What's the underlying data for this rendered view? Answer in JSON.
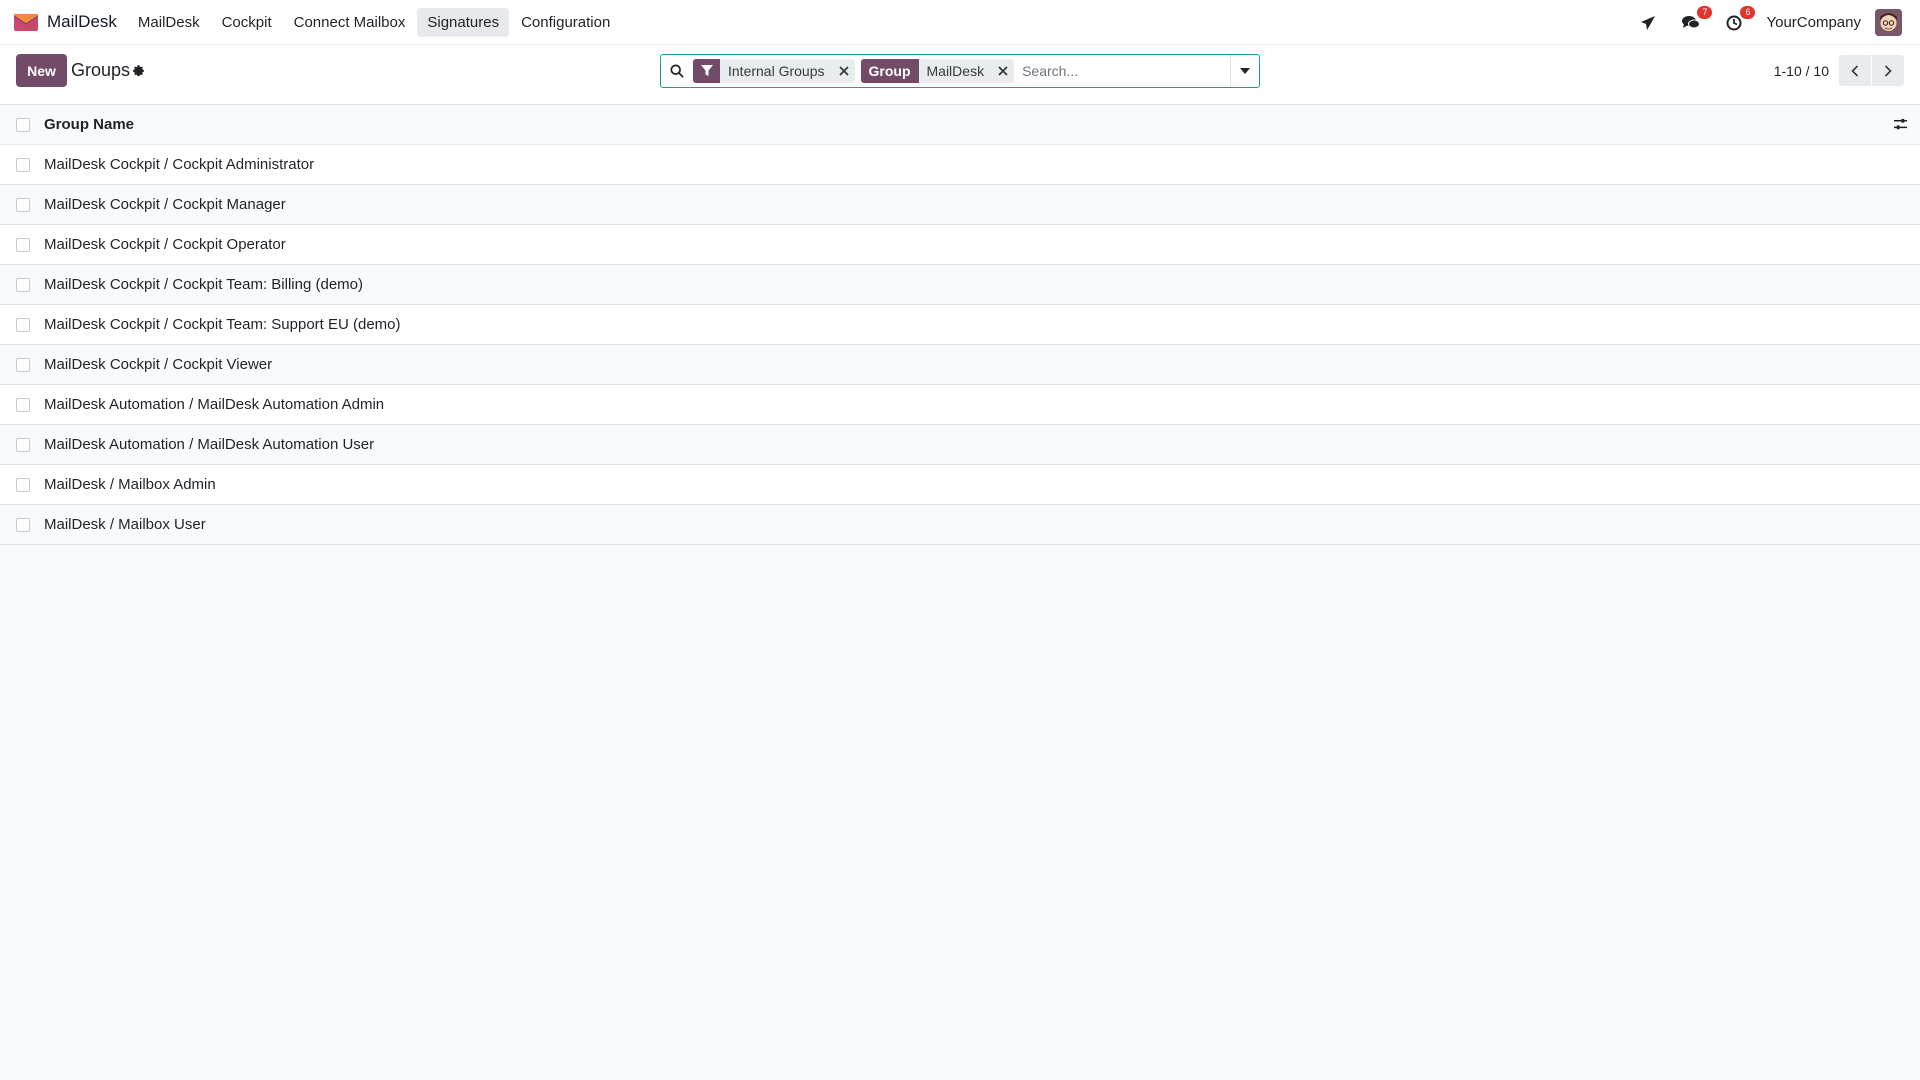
{
  "app": {
    "name": "MailDesk",
    "company": "YourCompany"
  },
  "nav": {
    "menu": [
      {
        "label": "MailDesk",
        "active": false
      },
      {
        "label": "Cockpit",
        "active": false
      },
      {
        "label": "Connect Mailbox",
        "active": false
      },
      {
        "label": "Signatures",
        "active": true
      },
      {
        "label": "Configuration",
        "active": false
      }
    ],
    "systray": {
      "send_icon": "paper-plane-icon",
      "messages_icon": "chat-bubbles-icon",
      "messages_badge": "7",
      "activities_icon": "clock-icon",
      "activities_badge": "6"
    }
  },
  "control_panel": {
    "new_label": "New",
    "title": "Groups",
    "search": {
      "placeholder": "Search...",
      "facets": [
        {
          "type": "filter",
          "icon": "filter-icon",
          "value": "Internal Groups"
        },
        {
          "type": "groupby",
          "label": "Group",
          "value": "MailDesk"
        }
      ]
    },
    "pager": {
      "value": "1-10 / 10"
    }
  },
  "list": {
    "columns": [
      "Group Name"
    ],
    "rows": [
      "MailDesk Cockpit / Cockpit Administrator",
      "MailDesk Cockpit / Cockpit Manager",
      "MailDesk Cockpit / Cockpit Operator",
      "MailDesk Cockpit / Cockpit Team: Billing (demo)",
      "MailDesk Cockpit / Cockpit Team: Support EU (demo)",
      "MailDesk Cockpit / Cockpit Viewer",
      "MailDesk Automation / MailDesk Automation Admin",
      "MailDesk Automation / MailDesk Automation User",
      "MailDesk / Mailbox Admin",
      "MailDesk / Mailbox User"
    ]
  },
  "colors": {
    "brand": "#714b67",
    "search_border": "#1c9ba6",
    "badge": "#e0342e"
  }
}
